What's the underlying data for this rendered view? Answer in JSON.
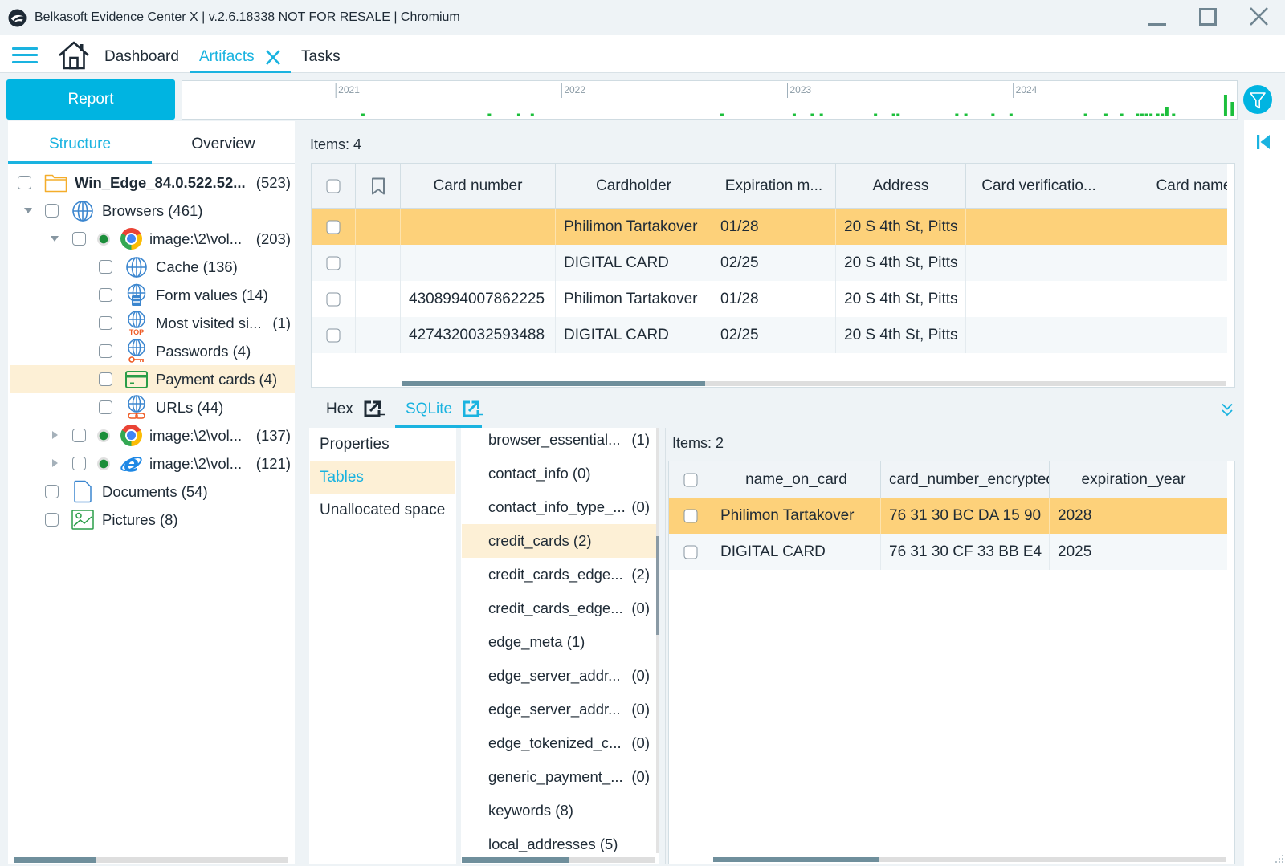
{
  "window": {
    "title": "Belkasoft Evidence Center X | v.2.6.18338 NOT FOR RESALE | Chromium",
    "controls": [
      "minimize-icon",
      "maximize-icon",
      "close-icon"
    ]
  },
  "nav": {
    "menu_icon": "hamburger-menu-icon",
    "home_icon": "home-icon",
    "tabs": [
      {
        "label": "Dashboard"
      },
      {
        "label": "Artifacts",
        "active": true,
        "closable": true
      },
      {
        "label": "Tasks"
      }
    ]
  },
  "toolbar": {
    "report_label": "Report",
    "filter_icon": "filter-icon"
  },
  "timeline": {
    "year_labels": [
      "2021",
      "2022",
      "2023",
      "2024"
    ],
    "range_years": [
      2020.32,
      2024.99
    ],
    "events": [
      {
        "t": 2021.12,
        "n": 1
      },
      {
        "t": 2021.68,
        "n": 1
      },
      {
        "t": 2021.81,
        "n": 1
      },
      {
        "t": 2021.87,
        "n": 1
      },
      {
        "t": 2022.71,
        "n": 1
      },
      {
        "t": 2023.03,
        "n": 1
      },
      {
        "t": 2023.11,
        "n": 1
      },
      {
        "t": 2023.15,
        "n": 1
      },
      {
        "t": 2023.39,
        "n": 1
      },
      {
        "t": 2023.47,
        "n": 1
      },
      {
        "t": 2023.49,
        "n": 1
      },
      {
        "t": 2023.75,
        "n": 1
      },
      {
        "t": 2023.79,
        "n": 1
      },
      {
        "t": 2023.91,
        "n": 1
      },
      {
        "t": 2023.99,
        "n": 1
      },
      {
        "t": 2024.32,
        "n": 1
      },
      {
        "t": 2024.41,
        "n": 1
      },
      {
        "t": 2024.48,
        "n": 1
      },
      {
        "t": 2024.55,
        "n": 1
      },
      {
        "t": 2024.57,
        "n": 1
      },
      {
        "t": 2024.59,
        "n": 1
      },
      {
        "t": 2024.61,
        "n": 1
      },
      {
        "t": 2024.64,
        "n": 1
      },
      {
        "t": 2024.66,
        "n": 1
      },
      {
        "t": 2024.68,
        "n": 4
      },
      {
        "t": 2024.71,
        "n": 1
      },
      {
        "t": 2024.94,
        "n": 9
      },
      {
        "t": 2024.97,
        "n": 6
      }
    ]
  },
  "left_panel": {
    "tabs": [
      {
        "label": "Structure",
        "active": true
      },
      {
        "label": "Overview"
      }
    ],
    "tree": [
      {
        "label": "Win_Edge_84.0.522.52...",
        "count": "(523)",
        "icon": "folder-icon"
      },
      {
        "label": "Browsers (461)",
        "icon": "globe-icon",
        "expanded": true
      },
      {
        "label": "image:\\2\\vol...",
        "count": "(203)",
        "icon": "chrome-icon",
        "status": "green",
        "expanded": true
      },
      {
        "label": "Cache (136)",
        "icon": "globe-icon"
      },
      {
        "label": "Form values (14)",
        "icon": "form-values-icon"
      },
      {
        "label": "Most visited si...",
        "count": "(1)",
        "icon": "most-visited-icon"
      },
      {
        "label": "Passwords (4)",
        "icon": "passwords-icon"
      },
      {
        "label": "Payment cards (4)",
        "icon": "payment-card-icon",
        "selected": true
      },
      {
        "label": "URLs (44)",
        "icon": "urls-icon"
      },
      {
        "label": "image:\\2\\vol...",
        "count": "(137)",
        "icon": "chrome-icon",
        "status": "green",
        "expanded": false
      },
      {
        "label": "image:\\2\\vol...",
        "count": "(121)",
        "icon": "internet-explorer-icon",
        "status": "green",
        "expanded": false
      },
      {
        "label": "Documents (54)",
        "icon": "document-icon"
      },
      {
        "label": "Pictures (8)",
        "icon": "pictures-icon"
      }
    ]
  },
  "main": {
    "items_label": "Items: 4",
    "columns": [
      "Card number",
      "Cardholder",
      "Expiration m...",
      "Address",
      "Card verificatio...",
      "Card name"
    ],
    "rows": [
      {
        "card_number": "",
        "cardholder": "Philimon Tartakover",
        "expiration": "01/28",
        "address": "20 S 4th St, Pitts",
        "cvv": "",
        "card_name": "",
        "selected": true
      },
      {
        "card_number": "",
        "cardholder": "DIGITAL CARD",
        "expiration": "02/25",
        "address": "20 S 4th St, Pitts",
        "cvv": "",
        "card_name": ""
      },
      {
        "card_number": "4308994007862225",
        "cardholder": "Philimon Tartakover",
        "expiration": "01/28",
        "address": "20 S 4th St, Pitts",
        "cvv": "",
        "card_name": ""
      },
      {
        "card_number": "4274320032593488",
        "cardholder": "DIGITAL CARD",
        "expiration": "02/25",
        "address": "20 S 4th St, Pitts",
        "cvv": "",
        "card_name": ""
      }
    ]
  },
  "detail": {
    "tabs": [
      {
        "label": "Hex",
        "icon": "open-external-icon"
      },
      {
        "label": "SQLite",
        "icon": "open-external-icon",
        "active": true
      }
    ],
    "nav": [
      {
        "label": "Properties"
      },
      {
        "label": "Tables",
        "active": true
      },
      {
        "label": "Unallocated space"
      }
    ],
    "tables": [
      {
        "name": "browser_essential...",
        "count": "(1)"
      },
      {
        "name": "contact_info",
        "count": "(0)"
      },
      {
        "name": "contact_info_type_...",
        "count": "(0)"
      },
      {
        "name": "credit_cards",
        "count": "(2)",
        "selected": true
      },
      {
        "name": "credit_cards_edge...",
        "count": "(2)"
      },
      {
        "name": "credit_cards_edge...",
        "count": "(0)"
      },
      {
        "name": "edge_meta",
        "count": "(1)"
      },
      {
        "name": "edge_server_addr...",
        "count": "(0)"
      },
      {
        "name": "edge_server_addr...",
        "count": "(0)"
      },
      {
        "name": "edge_tokenized_c...",
        "count": "(0)"
      },
      {
        "name": "generic_payment_...",
        "count": "(0)"
      },
      {
        "name": "keywords",
        "count": "(8)"
      },
      {
        "name": "local_addresses",
        "count": "(5)"
      }
    ],
    "records": {
      "items_label": "Items: 2",
      "columns": [
        "name_on_card",
        "card_number_encrypted",
        "expiration_year"
      ],
      "rows": [
        {
          "name_on_card": "Philimon Tartakover",
          "card_number_encrypted": "76 31 30 BC DA 15 90",
          "expiration_year": "2028",
          "selected": true
        },
        {
          "name_on_card": "DIGITAL CARD",
          "card_number_encrypted": "76 31 30 CF 33 BB E4",
          "expiration_year": "2025"
        }
      ]
    }
  },
  "colors": {
    "accent": "#00b4e1",
    "row_selected": "#fdd17a",
    "item_highlight": "#fdf0d6",
    "timeline_bar": "#1cbf3c",
    "status_green": "#1b8e3a"
  }
}
